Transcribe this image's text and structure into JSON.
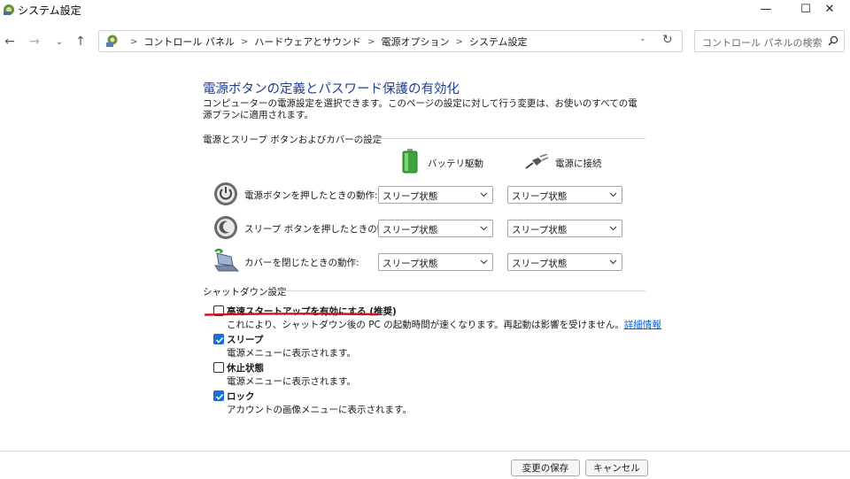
{
  "window": {
    "title": "システム設定",
    "minimize_glyph": "—",
    "maximize_glyph": "☐",
    "close_glyph": "✕"
  },
  "nav": {
    "back": "←",
    "forward": "→",
    "history": "⌄",
    "up": "↑",
    "breadcrumb": [
      "コントロール パネル",
      "ハードウェアとサウンド",
      "電源オプション",
      "システム設定"
    ],
    "breadcrumb_sep": ">",
    "dropdown_glyph": "⌄",
    "refresh_glyph": "↻",
    "search_placeholder": "コントロール パネルの検索"
  },
  "content": {
    "title": "電源ボタンの定義とパスワード保護の有効化",
    "description": "コンピューターの電源設定を選択できます。このページの設定に対して行う変更は、お使いのすべての電源プランに適用されます。",
    "section_buttons": "電源とスリープ ボタンおよびカバーの設定",
    "col_battery": "バッテリ駆動",
    "col_plugged": "電源に接続",
    "rows": [
      {
        "label": "電源ボタンを押したときの動作:",
        "battery": "スリープ状態",
        "plugged": "スリープ状態",
        "icon": "power-icon"
      },
      {
        "label": "スリープ ボタンを押したときの動作:",
        "battery": "スリープ状態",
        "plugged": "スリープ状態",
        "icon": "sleep-icon"
      },
      {
        "label": "カバーを閉じたときの動作:",
        "battery": "スリープ状態",
        "plugged": "スリープ状態",
        "icon": "laptop-lid-icon"
      }
    ],
    "section_shutdown": "シャットダウン設定",
    "shutdown": {
      "fast_startup": {
        "label": "高速スタートアップを有効にする (推奨)",
        "checked": false,
        "desc": "これにより、シャットダウン後の PC の起動時間が速くなります。再起動は影響を受けません。",
        "link": "詳細情報"
      },
      "sleep": {
        "label": "スリープ",
        "checked": true,
        "desc": "電源メニューに表示されます。"
      },
      "hibernate": {
        "label": "休止状態",
        "checked": false,
        "desc": "電源メニューに表示されます。"
      },
      "lock": {
        "label": "ロック",
        "checked": true,
        "desc": "アカウントの画像メニューに表示されます。"
      }
    }
  },
  "footer": {
    "save": "変更の保存",
    "cancel": "キャンセル"
  },
  "colors": {
    "title_blue": "#1e3f93",
    "link_blue": "#0b5fc8",
    "checkbox_blue": "#1a6ed8",
    "annotation_red": "#d0101a"
  }
}
